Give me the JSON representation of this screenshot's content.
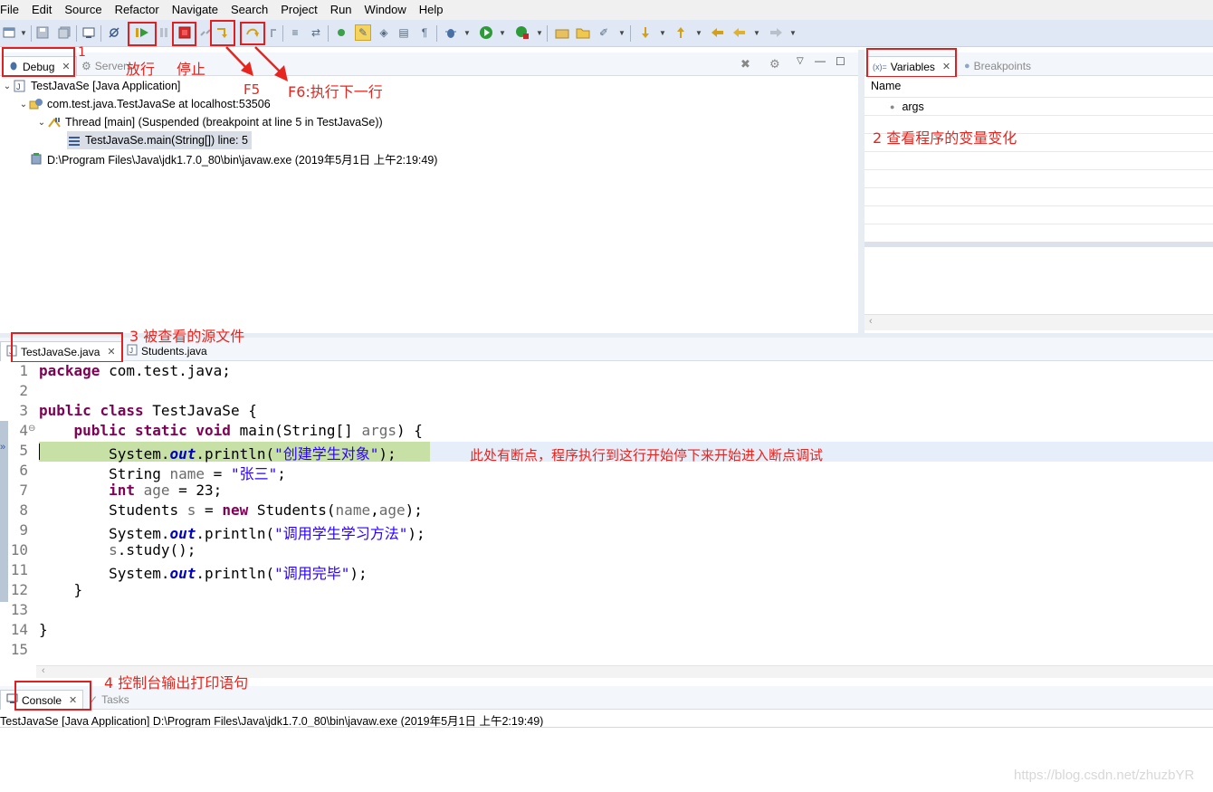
{
  "menu": [
    "File",
    "Edit",
    "Source",
    "Refactor",
    "Navigate",
    "Search",
    "Project",
    "Run",
    "Window",
    "Help"
  ],
  "debug_panel": {
    "tab_debug": "Debug",
    "tab_servers": "Servers",
    "tree": {
      "app": "TestJavaSe [Java Application]",
      "vm": "com.test.java.TestJavaSe at localhost:53506",
      "thread": "Thread [main] (Suspended (breakpoint at line 5 in TestJavaSe))",
      "frame": "TestJavaSe.main(String[]) line: 5",
      "process": "D:\\Program Files\\Java\\jdk1.7.0_80\\bin\\javaw.exe (2019年5月1日 上午2:19:49)"
    }
  },
  "variables_panel": {
    "tab_variables": "Variables",
    "tab_variables_prefix": "(x)=",
    "tab_breakpoints": "Breakpoints",
    "column_name": "Name",
    "rows": [
      "args"
    ]
  },
  "editor": {
    "tabs": [
      "TestJavaSe.java",
      "Students.java"
    ],
    "breakpoint_note": "此处有断点，程序执行到这行开始停下来开始进入断点调试"
  },
  "console_panel": {
    "tab_console": "Console",
    "tab_tasks": "Tasks",
    "status": "TestJavaSe [Java Application] D:\\Program Files\\Java\\jdk1.7.0_80\\bin\\javaw.exe (2019年5月1日 上午2:19:49)"
  },
  "annotations": {
    "a1_num": "1",
    "resume": "放行",
    "stop": "停止",
    "f5": "F5",
    "f6": "F6:执行下一行",
    "a2": "2   查看程序的变量变化",
    "a3": "3   被查看的源文件",
    "a4": "4   控制台输出打印语句"
  },
  "watermark": "https://blog.csdn.net/zhuzbYR",
  "colors": {
    "annotation_red": "#e8241e",
    "current_line": "#c7e0a6",
    "toolbar_bg": "#dfe8f4",
    "keyword": "#7f0055",
    "string": "#2a00ff"
  }
}
